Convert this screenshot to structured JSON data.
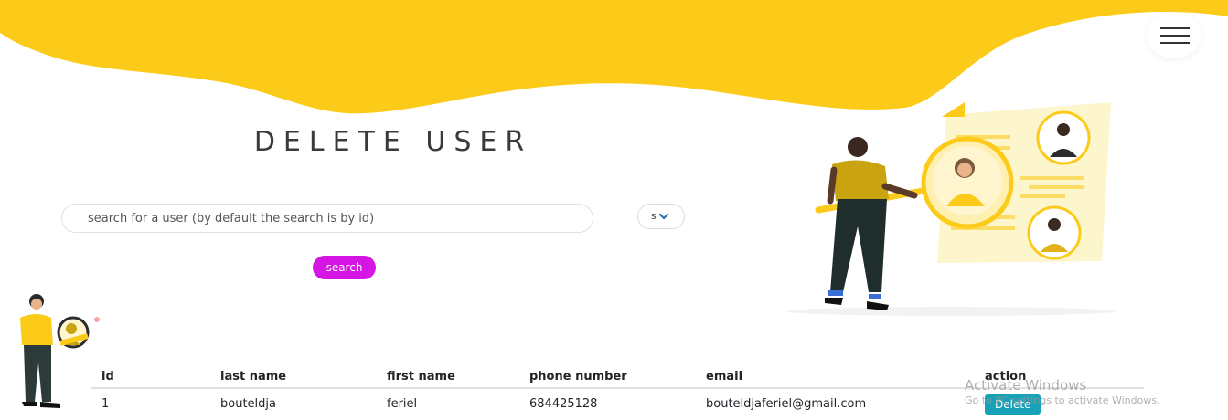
{
  "header": {
    "title": "DELETE USER",
    "menu_icon": "hamburger-menu-icon",
    "accent_color": "#fccb1a"
  },
  "search": {
    "placeholder": "search for a user (by default the search is by id)",
    "value": "",
    "select_value": "s",
    "button_label": "search",
    "button_color": "#d415e3"
  },
  "table": {
    "headers": {
      "id": "id",
      "last_name": "last name",
      "first_name": "first name",
      "phone": "phone number",
      "email": "email",
      "action": "action"
    },
    "rows": [
      {
        "id": "1",
        "last_name": "bouteldja",
        "first_name": "feriel",
        "phone": "684425128",
        "email": "bouteldjaferiel@gmail.com",
        "action_label": "Delete"
      }
    ]
  },
  "watermark": {
    "title": "Activate Windows",
    "subtitle": "Go to PC settings to activate Windows."
  }
}
